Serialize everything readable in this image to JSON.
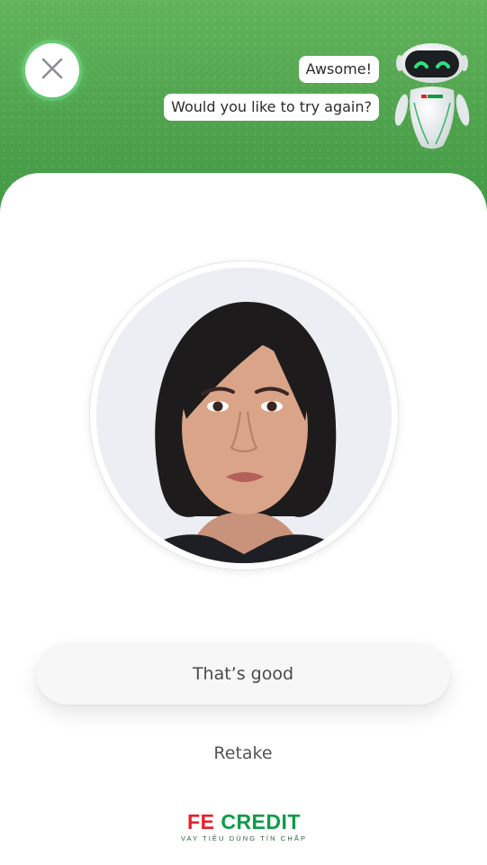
{
  "header": {
    "close_icon": "close-icon",
    "bubbles": [
      "Awsome!",
      "Would you like to try again?"
    ],
    "assistant": {
      "icon": "robot-assistant-icon",
      "badge_text": "FE CREDIT"
    }
  },
  "photo": {
    "description_icon": "selfie-portrait"
  },
  "actions": {
    "confirm_label": "That’s good",
    "retake_label": "Retake"
  },
  "brand": {
    "name_part1": "FE",
    "name_part2": "CREDIT",
    "tagline": "VAY TIÊU DÙNG TÍN CHẤP"
  },
  "colors": {
    "header_green": "#4ea24c",
    "brand_red": "#e8202a",
    "brand_green": "#0f9b48",
    "robot_eye_glow": "#2fe07f"
  }
}
